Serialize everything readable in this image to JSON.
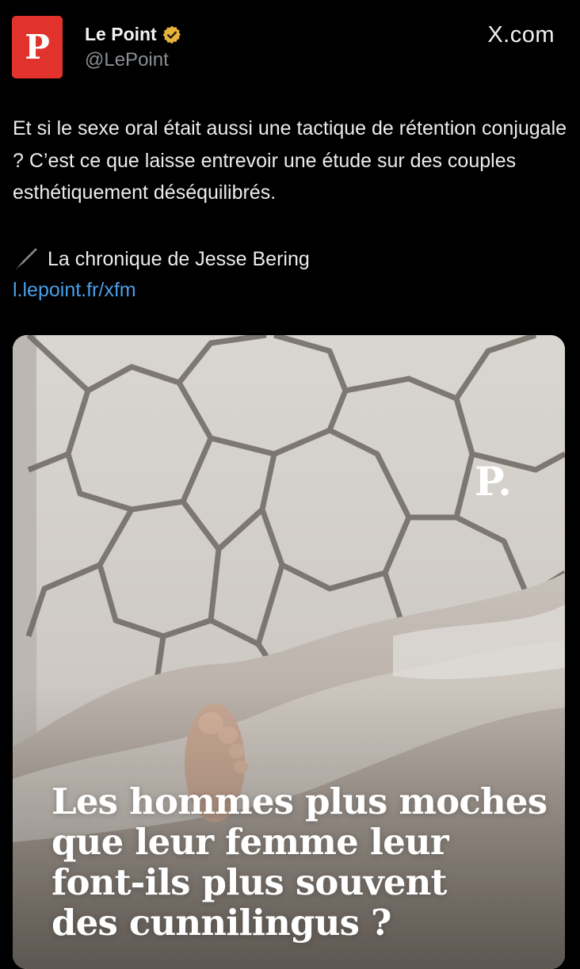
{
  "header": {
    "avatar_letter": "P",
    "display_name": "Le Point",
    "handle": "@LePoint",
    "source": "X.com",
    "verified_icon": "verified-badge-icon",
    "verified_color": "#e8b33a",
    "avatar_color": "#e1332b"
  },
  "tweet": {
    "text": "Et si le sexe oral était aussi une tactique de rétention conjugale ? C’est ce que laisse entrevoir une étude sur des couples esthétiquement déséquilibrés.",
    "byline_icon": "fountain-pen-icon",
    "byline": "La chronique de Jesse Bering",
    "link": "l.lepoint.fr/xfm",
    "link_color": "#4a9fe8"
  },
  "media": {
    "brand_logo": "P.",
    "headline_lines": [
      "Les hommes plus moches",
      "que leur femme leur",
      "font-ils plus souvent",
      "des cunnilingus ?"
    ]
  }
}
